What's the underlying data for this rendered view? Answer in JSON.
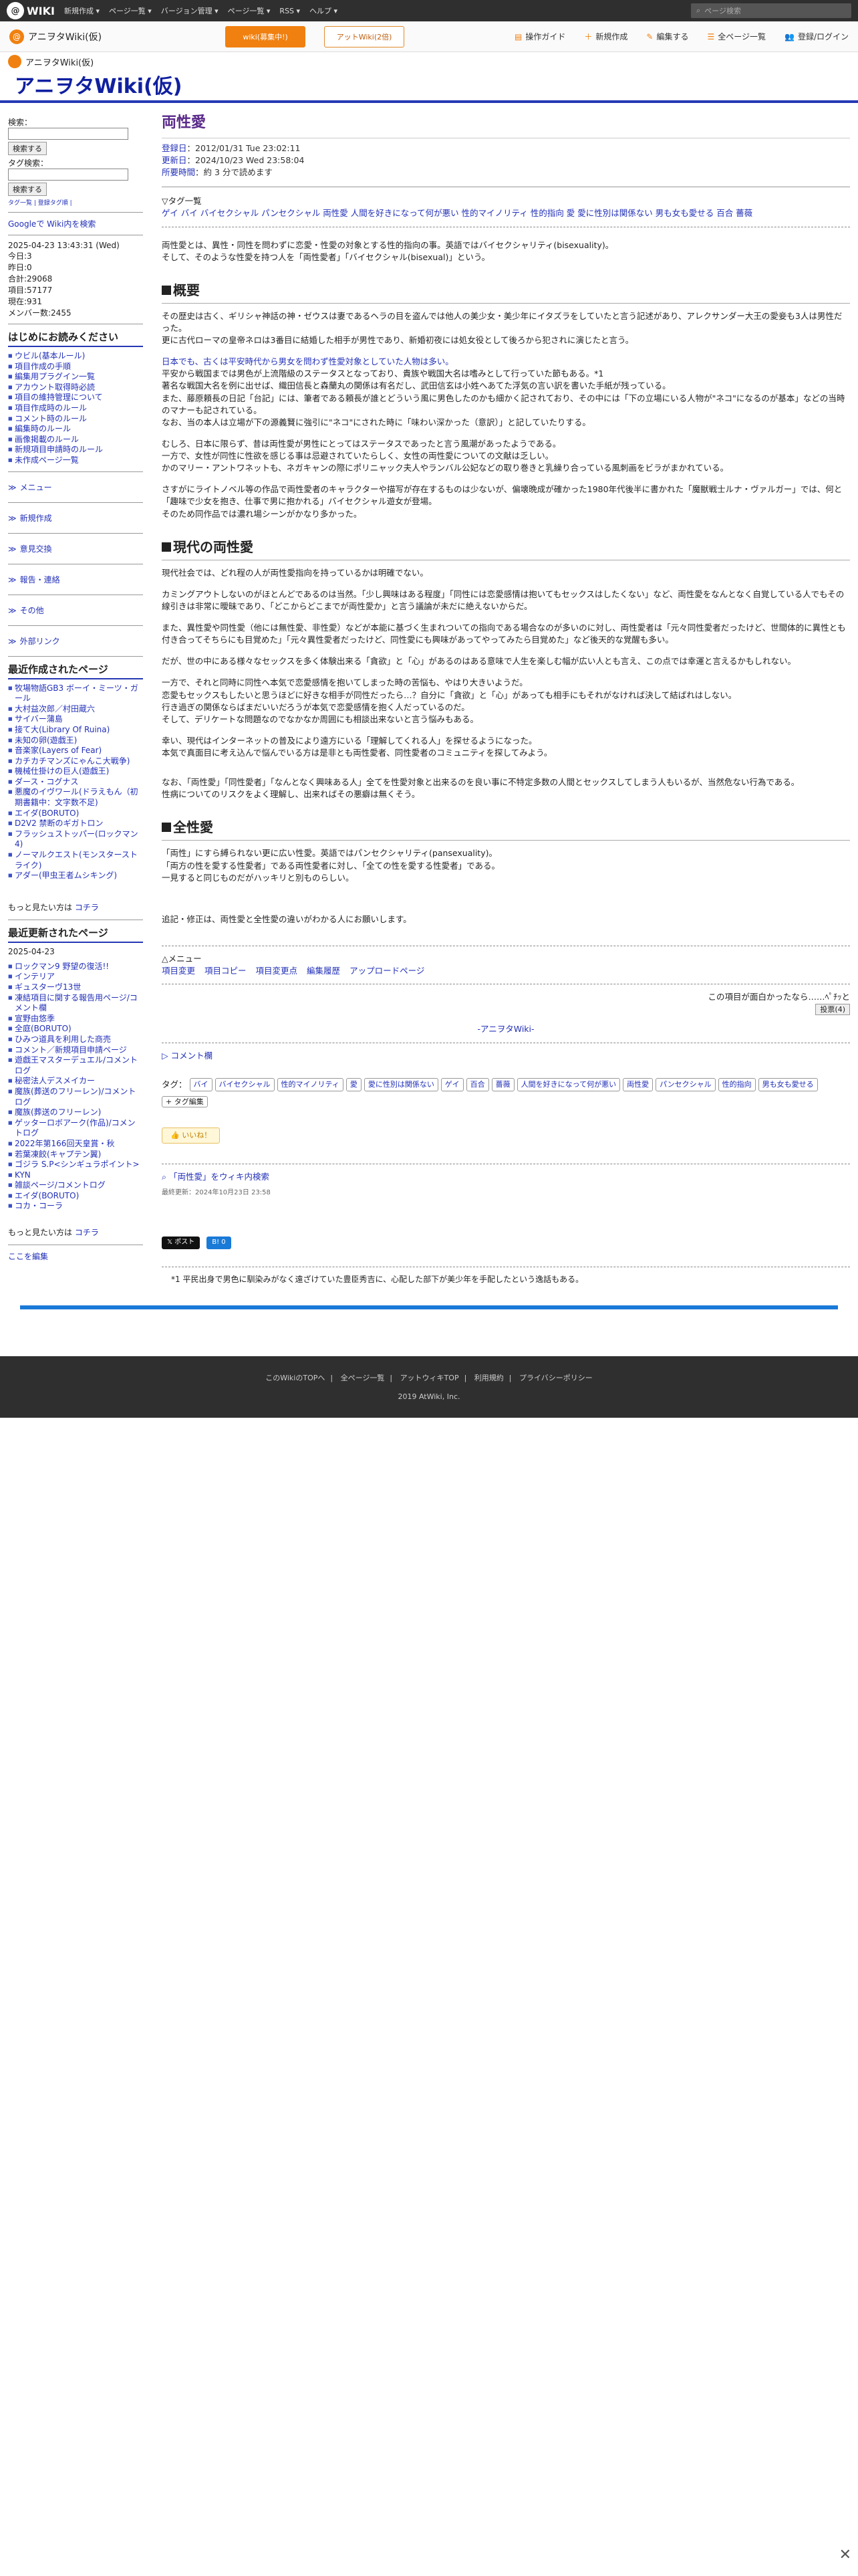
{
  "topbar": {
    "logo": "WIKI",
    "menus": [
      "新規作成 ▾",
      "ページ一覧 ▾",
      "バージョン管理 ▾",
      "ページ一覧 ▾",
      "RSS ▾",
      "ヘルプ ▾"
    ],
    "search_placeholder": "ページ検索"
  },
  "secbar": {
    "wiki_name": "アニヲタWiki(仮)",
    "orange_btn": "wiki(募集中!)",
    "white_btn": "アットWiki(2倍)",
    "actions": [
      "操作ガイド",
      "新規作成",
      "編集する",
      "全ページ一覧",
      "登録/ログイン"
    ]
  },
  "header": {
    "small_name": "アニヲタWiki(仮)",
    "title": "アニヲタWiki(仮)"
  },
  "sidebar": {
    "search_label": "検索：",
    "search_btn": "検索する",
    "tag_label": "タグ検索：",
    "tag_btn": "検索する",
    "tag_links": "タグ一覧 | 登録タグ順 |",
    "google": "Googleで Wiki内を検索",
    "date": "2025-04-23 13:43:31 (Wed)",
    "stats": [
      "今日:3",
      "昨日:0",
      "合計:29068",
      "項目:57177",
      "現在:931",
      "メンバー数:2455"
    ],
    "intro_title": "はじめにお読みください",
    "intro_items": [
      "ウビル(基本ルール)",
      "項目作成の手順",
      "編集用プラグイン一覧",
      "アカウント取得時必読",
      "項目の維持管理について",
      "項目作成時のルール",
      "コメント時のルール",
      "編集時のルール",
      "画像掲載のルール",
      "新規項目申請時のルール",
      "未作成ページ一覧"
    ],
    "cats": [
      "メニュー",
      "新規作成",
      "意見交換",
      "報告・連絡",
      "その他",
      "外部リンク"
    ],
    "recent_title": "最近作成されたページ",
    "recent_items": [
      "牧場物語GB3 ボーイ・ミーツ・ガール",
      "大村益次郎／村田蔵六",
      "サイバー蒲島",
      "接て大(Library Of Ruina)",
      "未知の卵(遊戯王)",
      "音楽家(Layers of Fear)",
      "カチカチマンズにゃんこ大戦争)",
      "機械仕掛けの巨人(遊戯王)",
      "ダース・コグナス",
      "悪魔のイヴワール(ドラえもん（初期書籍中：文字数不足)",
      "エイダ(BORUTO)",
      "D2V2 禁断のギガトロン",
      "フラッシュストッパー(ロックマン4)",
      "ノーマルクエスト(モンスターストライク)",
      "アダー(甲虫王者ムシキング)"
    ],
    "more1_label": "もっと見たい方は",
    "more1_link": "コチラ",
    "updated_title": "最近更新されたページ",
    "updated_date": "2025-04-23",
    "updated_items": [
      "ロックマン9 野望の復活!!",
      "インテリア",
      "ギュスターヴ13世",
      "凍結項目に関する報告用ページ/コメント欄",
      "宣野由悠季",
      "全庭(BORUTO)",
      "ひみつ道具を利用した商売",
      "コメント／新規項目申請ページ",
      "遊戯王マスターデュエル/コメントログ",
      "秘密法人デスメイカー",
      "魔族(葬送のフリーレン)/コメントログ",
      "魔族(葬送のフリーレン)",
      "ゲッターロボアーク(作品)/コメントログ",
      "2022年第166回天皇賞・秋",
      "若葉凍餃(キャプテン翼)",
      "ゴジラ S.P<シンギュラポイント>",
      "KYN",
      "雑談ページ/コメントログ",
      "エイダ(BORUTO)",
      "コカ・コーラ"
    ],
    "more2_label": "もっと見たい方は",
    "more2_link": "コチラ",
    "edit_here": "ここを編集"
  },
  "article": {
    "title": "両性愛",
    "registered_label": "登録日",
    "registered": "：2012/01/31 Tue 23:02:11",
    "updated_label": "更新日",
    "updated": "：2024/10/23 Wed 23:58:04",
    "read_label": "所要時間",
    "read": "：約 3 分で読めます",
    "tags_head": "▽タグ一覧",
    "tags_line": "ゲイ バイ バイセクシャル パンセクシャル 両性愛 人間を好きになって何が悪い 性的マイノリティ 性的指向 愛 愛に性別は関係ない 男も女も愛せる 百合 薔薇",
    "intro1": "両性愛とは、異性・同性を問わずに恋愛・性愛の対象とする性的指向の事。英語ではバイセクシャリティ(bisexuality)。",
    "intro2": "そして、そのような性愛を持つ人を「両性愛者」「バイセクシャル(bisexual)」という。",
    "h_overview": "概要",
    "ov1": "その歴史は古く、ギリシャ神話の神・ゼウスは妻であるヘラの目を盗んでは他人の美少女・美少年にイタズラをしていたと言う記述があり、アレクサンダー大王の愛妾も3人は男性だった。",
    "ov2": "更に古代ローマの皇帝ネロは3番目に結婚した相手が男性であり、新婚初夜には処女役として後ろから犯されに演じたと言う。",
    "ov3": "日本でも、古くは平安時代から男女を問わず性愛対象としていた人物は多い。",
    "ov4": "平安から戦国までは男色が上流階級のステータスとなっており、貴族や戦国大名は嗜みとして行っていた節もある。*1",
    "ov5": "著名な戦国大名を例に出せば、織田信長と森蘭丸の関係は有名だし、武田信玄は小姓へあてた浮気の言い訳を書いた手紙が残っている。",
    "ov6": "また、藤原頼長の日記「台記」には、筆者である頼長が誰とどういう風に男色したのかも細かく記されており、その中には「下の立場にいる人物が\"ネコ\"になるのが基本」などの当時のマナーも記されている。",
    "ov7": "なお、当の本人は立場が下の源義賢に強引に\"ネコ\"にされた時に「味わい深かった（意訳）」と記していたりする。",
    "ov8": "むしろ、日本に限らず、昔は両性愛が男性にとってはステータスであったと言う風潮があったようである。",
    "ov9": "一方で、女性が同性に性欲を感じる事は忌避されていたらしく、女性の両性愛についての文献は乏しい。",
    "ov10": "かのマリー・アントワネットも、ネガキャンの際にポリニャック夫人やランバル公妃などの取り巻きと乳繰り合っている風刺画をビラがまかれている。",
    "ov11": "さすがにライトノベル等の作品で両性愛者のキャラクターや描写が存在するものは少ないが、偏壊晩成が確かった1980年代後半に書かれた「魔獣戦士ルナ・ヴァルガー」では、何と「趣味で少女を抱き、仕事で男に抱かれる」バイセクシャル遊女が登場。",
    "ov12": "そのため同作品では濃れ場シーンがかなり多かった。",
    "h_modern": "現代の両性愛",
    "md1": "現代社会では、どれ程の人が両性愛指向を持っているかは明確でない。",
    "md2": "カミングアウトしないのがほとんどであるのは当然。「少し興味はある程度」「同性には恋愛感情は抱いてもセックスはしたくない」など、両性愛をなんとなく自覚している人でもその線引きは非常に曖昧であり、「どこからどこまでが両性愛か」と言う議論が未だに絶えないからだ。",
    "md3": "また、異性愛や同性愛（他には無性愛、非性愛）などが本能に基づく生まれついての指向である場合なのが多いのに対し、両性愛者は「元々同性愛者だったけど、世間体的に異性とも付き合ってそちらにも目覚めた」「元々異性愛者だったけど、同性愛にも興味があってやってみたら目覚めた」など後天的な覚醒も多い。",
    "md4": "だが、世の中にある様々なセックスを多く体験出来る「貪欲」と「心」があるのはある意味で人生を楽しむ幅が広い人とも言え、この点では幸運と言えるかもしれない。",
    "md5": "一方で、それと同時に同性へ本気で恋愛感情を抱いてしまった時の苦悩も、やはり大きいようだ。",
    "md6": "恋愛もセックスもしたいと思うほどに好きな相手が同性だったら…？自分に「貪欲」と「心」があっても相手にもそれがなければ決して結ばれはしない。",
    "md7": "行き過ぎの関係ならばまだいいだろうが本気で恋愛感情を抱く人だっているのだ。",
    "md8": "そして、デリケートな問題なのでなかなか周囲にも相談出来ないと言う悩みもある。",
    "md9": "幸い、現代はインターネットの普及により遠方にいる「理解してくれる人」を探せるようになった。",
    "md10": "本気で真面目に考え込んで悩んでいる方は是非とも両性愛者、同性愛者のコミュニティを探してみよう。",
    "md11": "なお、「両性愛」「同性愛者」「なんとなく興味ある人」全てを性愛対象と出来るのを良い事に不特定多数の人間とセックスしてしまう人もいるが、当然危ない行為である。",
    "md12": "性病についてのリスクをよく理解し、出来ればその悪癖は無くそう。",
    "h_pan": "全性愛",
    "pn1": "「両性」にすら縛られない更に広い性愛。英語ではパンセクシャリティ(pansexuality)。",
    "pn2": "「両方の性を愛する性愛者」である両性愛者に対し、「全ての性を愛する性愛者」である。",
    "pn3": "一見すると同じものだがハッキリと別ものらしい。",
    "closing": "追記・修正は、両性愛と全性愛の違いがわかる人にお願いします。",
    "menu_head": "△メニュー",
    "menu_links": [
      "項目変更",
      "項目コピー",
      "項目変更点",
      "編集履歴",
      "アップロードページ"
    ],
    "vote_text": "この項目が面白かったなら……ﾍﾟﾁｯと",
    "vote_btn": "投票(4)",
    "wiki_sig": "-アニヲタWiki-",
    "comment_toggle": "▷ コメント欄",
    "tag_label": "タグ：",
    "tag_chips": [
      "バイ",
      "バイセクシャル",
      "性的マイノリティ",
      "愛",
      "愛に性別は関係ない",
      "ゲイ",
      "百合",
      "薔薇",
      "人間を好きになって何が悪い",
      "両性愛",
      "パンセクシャル",
      "性的指向",
      "男も女も愛せる"
    ],
    "tag_edit": "+ タグ編集",
    "iine": "いいね！",
    "wiki_search": "「両性愛」をウィキ内検索",
    "last_update": "最終更新：2024年10月23日 23:58",
    "share_x": "ポスト",
    "share_b": "B! 0",
    "footnote": "*1 平民出身で男色に馴染みがなく遠ざけていた豊臣秀吉に、心配した部下が美少年を手配したという逸話もある。"
  },
  "footer": {
    "links": [
      "このWikiのTOPへ",
      "全ページ一覧",
      "アットウィキTOP",
      "利用規約",
      "プライバシーポリシー"
    ],
    "copy": "2019 AtWiki, Inc."
  }
}
